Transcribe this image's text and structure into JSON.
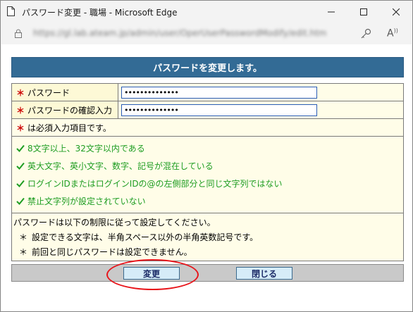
{
  "window": {
    "title": "パスワード変更 - 職場 - Microsoft Edge"
  },
  "addressbar": {
    "url": "https://gl.lab.ateam.jp/admin/user/OperUserPasswordModify/edit.htm"
  },
  "form": {
    "header": "パスワードを変更します。",
    "required_mark": "＊",
    "fields": [
      {
        "label": "パスワード",
        "value": "••••••••••••••"
      },
      {
        "label": "パスワードの確認入力",
        "value": "••••••••••••••"
      }
    ],
    "required_note": "は必須入力項目です。",
    "rules": [
      "8文字以上、32文字以内である",
      "英大文字、英小文字、数字、記号が混在している",
      "ログインIDまたはログインIDの@の左側部分と同じ文字列ではない",
      "禁止文字列が設定されていない"
    ],
    "limits_intro": "パスワードは以下の制限に従って設定してください。",
    "limits": [
      "設定できる文字は、半角スペース以外の半角英数記号です。",
      "前回と同じパスワードは設定できません。"
    ],
    "limit_mark": "＊"
  },
  "buttons": {
    "change": "変更",
    "close": "閉じる"
  },
  "colors": {
    "header_bg": "#336b95",
    "label_bg": "#fdf9d6",
    "rule_text": "#1e9d22",
    "required": "#cc0000",
    "highlight": "#e8141a"
  }
}
